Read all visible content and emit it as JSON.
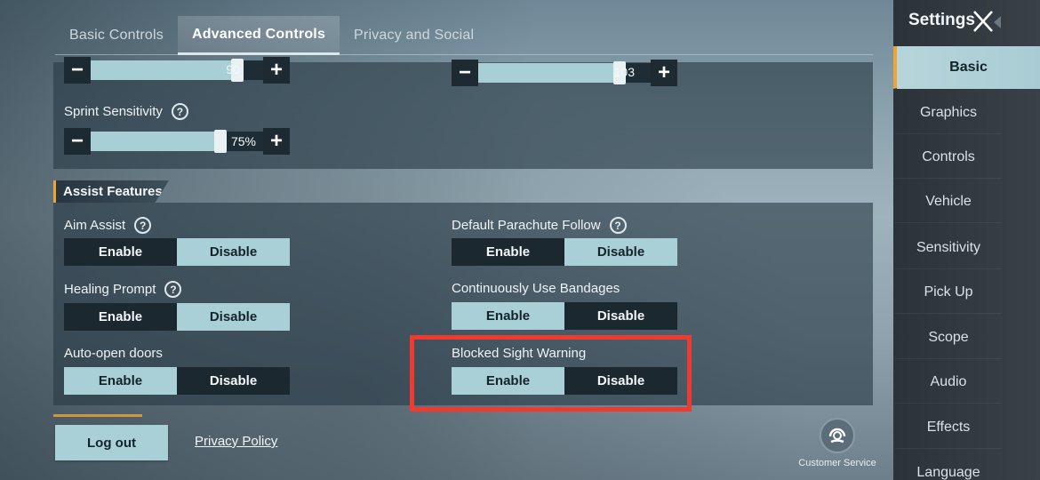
{
  "tabs": {
    "basic": "Basic Controls",
    "advanced": "Advanced Controls",
    "privacy": "Privacy and Social"
  },
  "sliders": {
    "top_left": {
      "value": "90",
      "fill_fraction": 0.85
    },
    "top_right": {
      "value": "103",
      "fill_fraction": 0.82
    },
    "sprint": {
      "label": "Sprint Sensitivity",
      "value": "75%",
      "fill_fraction": 0.75
    }
  },
  "assist": {
    "title": "Assist Features",
    "aim_assist": {
      "label": "Aim Assist",
      "enable": "Enable",
      "disable": "Disable",
      "selected": "Disable"
    },
    "parachute": {
      "label": "Default Parachute Follow",
      "enable": "Enable",
      "disable": "Disable",
      "selected": "Disable"
    },
    "healing": {
      "label": "Healing Prompt",
      "enable": "Enable",
      "disable": "Disable",
      "selected": "Disable"
    },
    "bandages": {
      "label": "Continuously Use Bandages",
      "enable": "Enable",
      "disable": "Disable",
      "selected": "Enable"
    },
    "doors": {
      "label": "Auto-open doors",
      "enable": "Enable",
      "disable": "Disable",
      "selected": "Enable"
    },
    "blocked_sight": {
      "label": "Blocked Sight Warning",
      "enable": "Enable",
      "disable": "Disable",
      "selected": "Enable"
    }
  },
  "footer": {
    "logout": "Log out",
    "privacy_policy": "Privacy Policy",
    "customer_service": "Customer Service"
  },
  "sidebar": {
    "title": "Settings",
    "items": [
      "Basic",
      "Graphics",
      "Controls",
      "Vehicle",
      "Sensitivity",
      "Pick Up",
      "Scope",
      "Audio",
      "Effects",
      "Language"
    ],
    "active": "Basic"
  },
  "colors": {
    "accent": "#f0a532",
    "selected_option": "#a9d0d7",
    "unselected_option": "#1c2830",
    "highlight": "#ee3a2f"
  }
}
